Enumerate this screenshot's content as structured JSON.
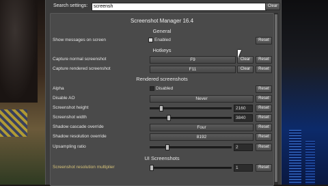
{
  "search": {
    "label": "Search settings:",
    "value": "screensh",
    "clear_label": "Clear"
  },
  "window": {
    "title": "Screenshot Manager 16.4"
  },
  "sections": {
    "general": "General",
    "hotkeys": "Hotkeys",
    "rendered": "Rendered screenshots",
    "ui": "UI Screenshots"
  },
  "rows": {
    "show_messages": {
      "label": "Show messages on screen",
      "value": "Enabled",
      "reset": "Reset"
    },
    "capture_normal": {
      "label": "Capture normal screenshot",
      "value": "F9",
      "clear": "Clear",
      "reset": "Reset"
    },
    "capture_rendered": {
      "label": "Capture rendered screenshot",
      "value": "F11",
      "clear": "Clear",
      "reset": "Reset"
    },
    "alpha": {
      "label": "Alpha",
      "value": "Disabled",
      "reset": "Reset"
    },
    "disable_ao": {
      "label": "Disable AO",
      "value": "Never",
      "reset": "Reset"
    },
    "height": {
      "label": "Screenshot height",
      "value": "2160",
      "reset": "Reset",
      "slider_fraction": 0.12
    },
    "width": {
      "label": "Screenshot width",
      "value": "3840",
      "reset": "Reset",
      "slider_fraction": 0.22
    },
    "cascade": {
      "label": "Shadow cascade override",
      "value": "Four",
      "reset": "Reset"
    },
    "shadow_res": {
      "label": "Shadow resolution override",
      "value": "8192",
      "reset": "Reset"
    },
    "upsampling": {
      "label": "Upsampling ratio",
      "value": "2",
      "reset": "Reset",
      "slider_fraction": 0.2
    },
    "ui_multiplier": {
      "label": "Screenshot resolution multiplier",
      "value": "1",
      "reset": "Reset",
      "slider_fraction": 0.0
    }
  },
  "colors": {
    "panel": "#4a4a4a",
    "highlight_label": "#d8c47a"
  }
}
